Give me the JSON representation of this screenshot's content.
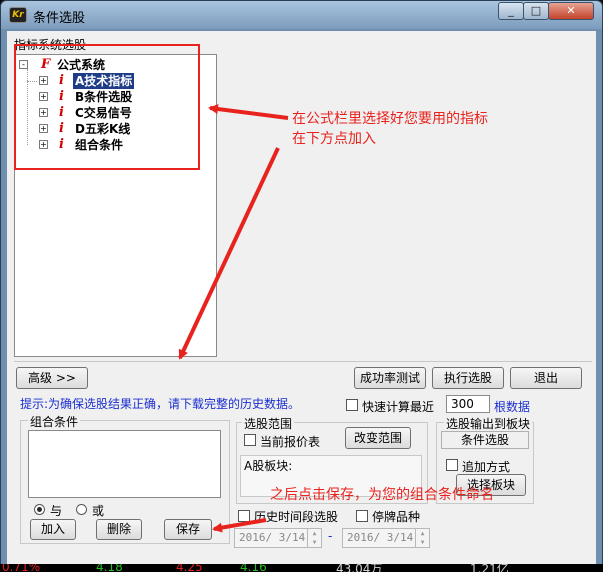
{
  "window": {
    "title": "条件选股",
    "controls": {
      "minimize": "_",
      "maximize": "□",
      "close": "✕"
    },
    "app_icon_text": "Kr"
  },
  "tree_section": {
    "label": "指标系统选股",
    "root": {
      "icon": "F",
      "label": "公式系统",
      "toggle": "-"
    },
    "items": [
      {
        "toggle": "+",
        "icon": "i",
        "label": "A技术指标",
        "selected": true
      },
      {
        "toggle": "+",
        "icon": "i",
        "label": "B条件选股"
      },
      {
        "toggle": "+",
        "icon": "i",
        "label": "C交易信号"
      },
      {
        "toggle": "+",
        "icon": "i",
        "label": "D五彩K线"
      },
      {
        "toggle": "+",
        "icon": "i",
        "label": "组合条件"
      }
    ]
  },
  "buttons": {
    "advanced": "高级 >>",
    "success_test": "成功率测试",
    "run": "执行选股",
    "exit": "退出",
    "change_range": "改变范围",
    "select_block": "选择板块",
    "add": "加入",
    "delete": "删除",
    "save": "保存"
  },
  "hint": "提示:为确保选股结果正确，请下载完整的历史数据。",
  "quick_calc": {
    "label": "快速计算最近",
    "value": "300",
    "suffix": "根数据",
    "checked": false
  },
  "combo": {
    "label": "组合条件",
    "and_label": "与",
    "or_label": "或",
    "and_selected": true
  },
  "range": {
    "label": "选股范围",
    "current_quote_label": "当前报价表",
    "block_label": "A股板块:"
  },
  "output": {
    "label": "选股输出到板块",
    "block_value": "条件选股",
    "append_label": "追加方式"
  },
  "history": {
    "label": "历史时间段选股",
    "suspended_label": "停牌品种",
    "from": "2016/ 3/14",
    "to": "2016/ 3/14",
    "dash": "-"
  },
  "annotations": {
    "top_line1": "在公式栏里选择好您要用的指标",
    "top_line2": "在下方点加入",
    "bottom": "之后点击保存，为您的组合条件命名"
  },
  "colors": {
    "annotation": "#e8231e",
    "selection": "#1f3c86",
    "hint_text": "#1a2fcf",
    "link_text": "#1a2fcf"
  },
  "status_strip": [
    {
      "text": "0.71%",
      "color": "#e02020"
    },
    {
      "text": "4.18",
      "color": "#20c020"
    },
    {
      "text": "4.25",
      "color": "#e02020"
    },
    {
      "text": "4.16",
      "color": "#20c020"
    },
    {
      "text": "43.04万",
      "color": "#d0d0d0"
    },
    {
      "text": "1.21亿",
      "color": "#d0d0d0"
    }
  ]
}
